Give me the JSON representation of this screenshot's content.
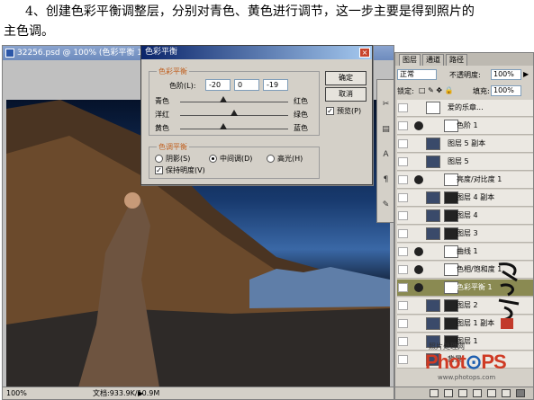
{
  "caption": {
    "line1": "4、创建色彩平衡调整层，分别对青色、黄色进行调节，这一步主要是得到照片的",
    "line2": "主色调。"
  },
  "document": {
    "title": "32256.psd @ 100% (色彩平衡 1, 色彩平衡",
    "zoom": "100%",
    "doc_info": "文档:933.9K/10.9M"
  },
  "dialog": {
    "title": "色彩平衡",
    "balance_group": "色彩平衡",
    "levels_label": "色阶(L):",
    "levels": [
      "-20",
      "0",
      "-19"
    ],
    "pairs": [
      {
        "left": "青色",
        "right": "红色",
        "pos": 0.4
      },
      {
        "left": "洋红",
        "right": "绿色",
        "pos": 0.5
      },
      {
        "left": "黄色",
        "right": "蓝色",
        "pos": 0.4
      }
    ],
    "tone_group": "色调平衡",
    "tones": [
      "阴影(S)",
      "中间调(D)",
      "高光(H)"
    ],
    "tone_selected": 1,
    "preserve_label": "保持明度(V)",
    "preserve_checked": true,
    "ok": "确定",
    "cancel": "取消",
    "preview_label": "预览(P)",
    "preview_checked": true
  },
  "layers_panel": {
    "tabs": [
      "图层",
      "通道",
      "路径"
    ],
    "active_tab": 0,
    "blend_mode": "正常",
    "opacity_label": "不透明度:",
    "opacity": "100%",
    "lock_label": "锁定:",
    "fill_label": "填充:",
    "fill": "100%",
    "layers": [
      {
        "name": "爱的乐章...",
        "kind": "text",
        "active": false
      },
      {
        "name": "色阶 1",
        "kind": "adjust",
        "active": false
      },
      {
        "name": "图层 5 副本",
        "kind": "plain",
        "active": false
      },
      {
        "name": "图层 5",
        "kind": "plain",
        "active": false
      },
      {
        "name": "亮度/对比度 1",
        "kind": "adjust",
        "active": false
      },
      {
        "name": "图层 4 副本",
        "kind": "masked",
        "active": false
      },
      {
        "name": "图层 4",
        "kind": "masked",
        "active": false
      },
      {
        "name": "图层 3",
        "kind": "masked",
        "active": false
      },
      {
        "name": "曲线 1",
        "kind": "adjust",
        "active": false
      },
      {
        "name": "色相/饱和度 1",
        "kind": "adjust",
        "active": false
      },
      {
        "name": "色彩平衡 1",
        "kind": "adjust",
        "active": true
      },
      {
        "name": "图层 2",
        "kind": "masked",
        "active": false
      },
      {
        "name": "图层 1 副本",
        "kind": "masked",
        "active": false
      },
      {
        "name": "图层 1",
        "kind": "masked",
        "active": false
      },
      {
        "name": "背景",
        "kind": "plain",
        "active": false
      }
    ]
  },
  "watermark": {
    "line1": "照片处理网",
    "brand_a": "Phot",
    "brand_b": "PS",
    "url": "www.photops.com"
  }
}
